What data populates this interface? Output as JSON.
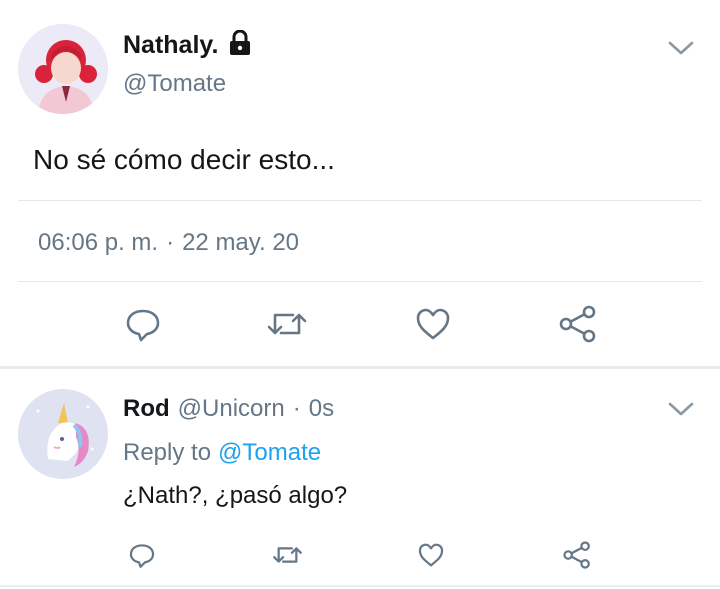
{
  "main_tweet": {
    "author_name": "Nathaly.",
    "author_handle": "@Tomate",
    "text": "No sé cómo decir esto...",
    "time": "06:06 p. m.",
    "separator": "·",
    "date": "22 may. 20",
    "icons": [
      "lock-icon",
      "chevron-down-icon",
      "reply-icon",
      "retweet-icon",
      "like-icon",
      "share-icon"
    ]
  },
  "reply_tweet": {
    "author_name": "Rod",
    "author_handle": "@Unicorn",
    "separator": "·",
    "time_ago": "0s",
    "reply_to_prefix": "Reply to",
    "reply_to_handle": "@Tomate",
    "text": "¿Nath?, ¿pasó algo?",
    "icons": [
      "chevron-down-icon",
      "reply-icon",
      "retweet-icon",
      "like-icon",
      "share-icon"
    ]
  },
  "colors": {
    "text": "#14171a",
    "secondary": "#657786",
    "link": "#1da1f2",
    "divider": "#e1e8ed"
  }
}
